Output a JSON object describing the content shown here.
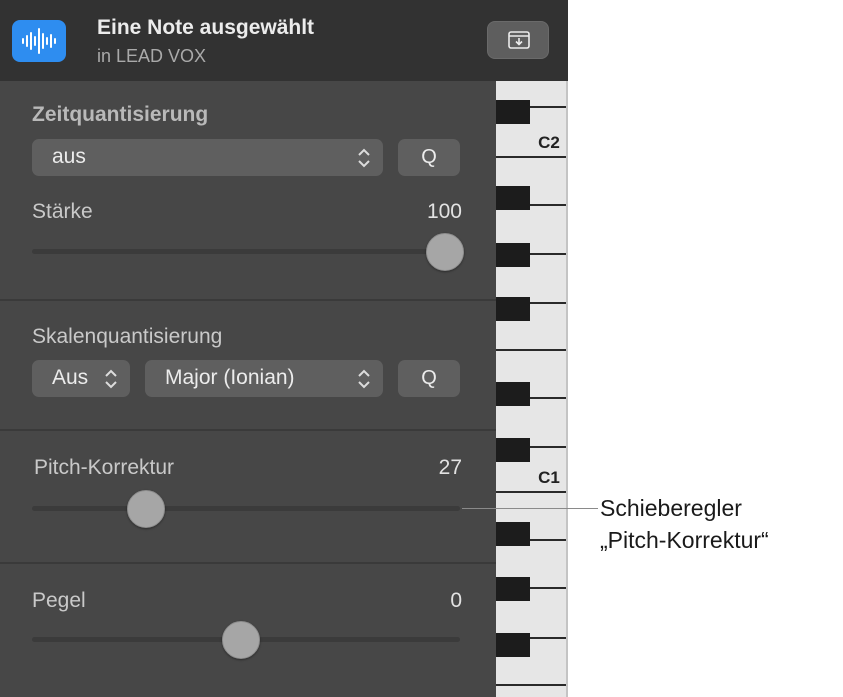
{
  "header": {
    "title": "Eine Note ausgewählt",
    "subtitle": "in LEAD VOX",
    "icon": "waveform-icon",
    "action_icon": "download-tray-icon"
  },
  "time_quantize": {
    "heading": "Zeitquantisierung",
    "value": "aus",
    "q_label": "Q",
    "strength_label": "Stärke",
    "strength_value": "100",
    "strength_level": 1.0
  },
  "scale_quantize": {
    "heading": "Skalenquantisierung",
    "key_value": "Aus",
    "scale_value": "Major (Ionian)",
    "q_label": "Q"
  },
  "pitch_correction": {
    "label": "Pitch-Korrektur",
    "value": "27",
    "level": 0.27
  },
  "gain": {
    "label": "Pegel",
    "value": "0",
    "level": 0.5
  },
  "piano": {
    "octave_labels": [
      "C2",
      "C1"
    ]
  },
  "callout": {
    "line1": "Schieberegler",
    "line2": "„Pitch-Korrektur“"
  },
  "colors": {
    "accent": "#2e8df0",
    "panel": "#474747",
    "header": "#323232"
  }
}
